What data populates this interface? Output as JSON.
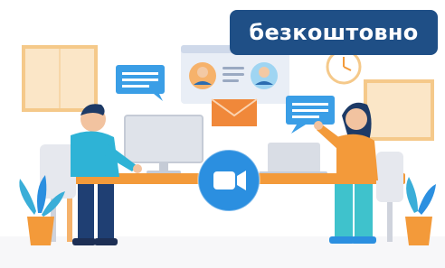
{
  "badge": {
    "label": "безкоштовно",
    "color": "#1f4f86"
  },
  "accent_colors": {
    "table": "#f39a3a",
    "video_button": "#2b8fe0",
    "chat_bubble": "#3a9ee6",
    "envelope": "#f0883a",
    "man_shirt": "#2eb3d6",
    "woman_top": "#f39a3a",
    "woman_pants": "#3fc2cc"
  },
  "icons": [
    "video-camera-icon",
    "chat-bubble-icon",
    "envelope-icon",
    "clock-icon",
    "plant-icon",
    "laptop-icon",
    "monitor-icon"
  ]
}
